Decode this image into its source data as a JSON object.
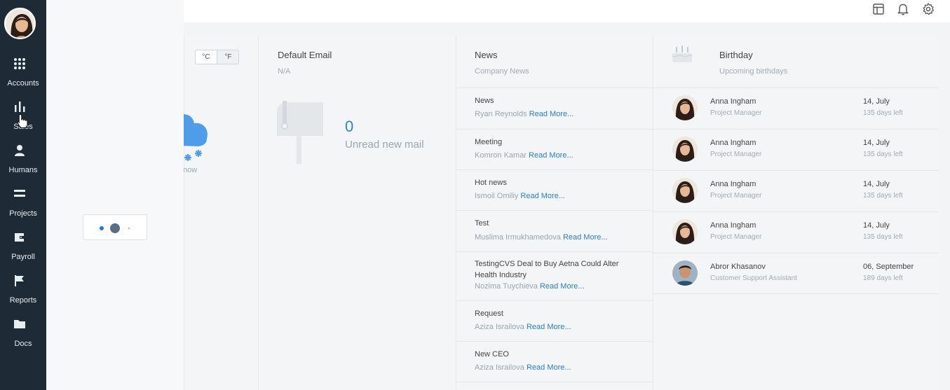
{
  "nav": {
    "items": [
      {
        "label": "Accounts",
        "icon": "grid-icon"
      },
      {
        "label": "Sales",
        "icon": "bar-chart-icon"
      },
      {
        "label": "Humans",
        "icon": "user-icon"
      },
      {
        "label": "Projects",
        "icon": "list-icon"
      },
      {
        "label": "Payroll",
        "icon": "wallet-icon"
      },
      {
        "label": "Reports",
        "icon": "flag-icon"
      },
      {
        "label": "Docs",
        "icon": "folder-icon"
      }
    ]
  },
  "weather": {
    "unit_c": "°C",
    "unit_f": "°F",
    "condition_fragment": "now"
  },
  "email": {
    "title": "Default Email",
    "address": "N/A",
    "unread_count": "0",
    "unread_label": "Unread new mail"
  },
  "news": {
    "title": "News",
    "subtitle": "Company News",
    "read_more": "Read More...",
    "items": [
      {
        "title": "News",
        "author": "Ryan Reynolds"
      },
      {
        "title": "Meeting",
        "author": "Komron Kamar"
      },
      {
        "title": "Hot news",
        "author": "Ismoil Omiliy"
      },
      {
        "title": "Test",
        "author": "Muslima Irmukhamedova"
      },
      {
        "title": "TestingCVS Deal to Buy Aetna Could Alter Health Industry",
        "author": "Nozima Tuychieva"
      },
      {
        "title": "Request",
        "author": "Aziza Israilova"
      },
      {
        "title": "New CEO",
        "author": "Aziza Israilova"
      }
    ]
  },
  "birthday": {
    "title": "Birthday",
    "subtitle": "Upcoming birthdays",
    "people": [
      {
        "name": "Anna Ingham",
        "role": "Project Manager",
        "date": "14, July",
        "left": "135 days left"
      },
      {
        "name": "Anna Ingham",
        "role": "Project Manager",
        "date": "14, July",
        "left": "135 days left"
      },
      {
        "name": "Anna Ingham",
        "role": "Project Manager",
        "date": "14, July",
        "left": "135 days left"
      },
      {
        "name": "Anna Ingham",
        "role": "Project Manager",
        "date": "14, July",
        "left": "135 days left"
      },
      {
        "name": "Abror Khasanov",
        "role": "Customer Support Assistant",
        "date": "06, September",
        "left": "189 days left"
      }
    ]
  },
  "colors": {
    "nav_bg": "#1e2a35",
    "accent": "#2a7fca"
  }
}
